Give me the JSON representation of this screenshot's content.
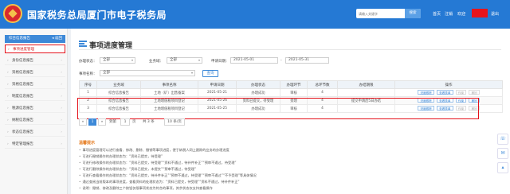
{
  "header": {
    "title": "国家税务总局厦门市电子税务局",
    "search_placeholder": "请输入关键字",
    "search_button": "搜索",
    "links": [
      "首页",
      "注销",
      "欢迎"
    ],
    "logout": "退出"
  },
  "sidebar": {
    "head_label": "综合信息报告",
    "back_label": "返回",
    "items": [
      {
        "label": "事项进度管理",
        "active": true
      },
      {
        "label": "身份信息报告"
      },
      {
        "label": "资格信息报告"
      },
      {
        "label": "资格信息报告"
      },
      {
        "label": "制度信息报告"
      },
      {
        "label": "税源信息报告"
      },
      {
        "label": "纳税信息报告"
      },
      {
        "label": "状态信息报告"
      },
      {
        "label": "特定管理报告"
      }
    ]
  },
  "main": {
    "page_title": "事项进度管理",
    "filters": {
      "status_label": "办理状态：",
      "status_value": "全部",
      "business_label": "业务域：",
      "business_value": "全部",
      "date_label": "申请日期：",
      "date_from": "2021-05-01",
      "date_sep": "-",
      "date_to": "2021-05-31",
      "name_label": "事项名称：",
      "name_value": "全部",
      "query_button": "查询"
    },
    "table": {
      "columns": [
        "序号",
        "业务域",
        "事项名称",
        "申请日期",
        "办理状态",
        "办理环节",
        "总环节数",
        "办结期限",
        "操作"
      ],
      "rows": [
        {
          "no": "1",
          "domain": "综合信息报告",
          "name": "土地（矿）出售备案",
          "date": "2021-05-21",
          "status": "办理成功",
          "step": "审核",
          "total": "4",
          "deadline": ""
        },
        {
          "no": "2",
          "domain": "综合信息报告",
          "name": "土地增值税项目登记",
          "date": "2021-05-26",
          "status": "资料已提交，待受理",
          "step": "受理",
          "total": "4",
          "deadline": "提交申请后5日办结"
        },
        {
          "no": "3",
          "domain": "综合信息报告",
          "name": "土地增值税项目登记",
          "date": "2021-05-25",
          "status": "办理成功",
          "step": "审核",
          "total": "4",
          "deadline": ""
        }
      ],
      "actions": [
        "进度跟踪",
        "查看表单",
        "作废",
        "撤回"
      ]
    },
    "pager": {
      "prev": "«",
      "current": "1",
      "next": "»",
      "goto_label": "到第",
      "goto_value": "1",
      "page_unit": "页",
      "total_text": "共 3 条",
      "page_size": "10 条/页"
    },
    "tips": {
      "title": "温馨提示",
      "lines": [
        "事项进度管理可以进行查看、修改、删除、撤销等事项进度，便于纳税人网上跟踪的业务的办理进度",
        "可进行撤销操作的办理状态为：“资料已提交，待受理”",
        "可进行修改操作的办理状态为：“资料已提交，待受理”“资料不通过，待补件补正”“预审不通过，待受理”",
        "可进行删除操作的办理状态为：“资料已提交，未提交”“预审不通过，待受理”",
        "可进行查看操作的办理状态为：“资料已提交，待补件补正”“预审不通过，待受理”“预审不通过”“不予受理”等具体情况",
        "通过查阅当前版本的事项进度，查看资料的处理状态为：“资料已提交，待受理”“资料不通过，待补件补正”",
        "说明：撤销、修改及删除三个按钮仅限事项状态为符合的事项，其余状态仅支持查看操作"
      ]
    }
  },
  "colors": {
    "header_blue": "#2579d4",
    "highlight_red": "#e5121b",
    "accent_blue": "#3d89d8"
  }
}
